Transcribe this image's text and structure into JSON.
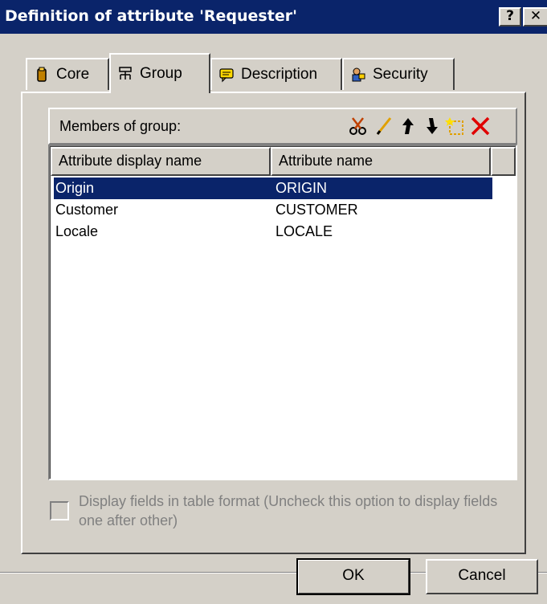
{
  "window": {
    "title": "Definition of attribute 'Requester'",
    "help_label": "?",
    "close_label": "✕"
  },
  "tabs": [
    {
      "label": "Core",
      "icon": "core-icon"
    },
    {
      "label": "Group",
      "icon": "group-icon",
      "active": true
    },
    {
      "label": "Description",
      "icon": "description-icon"
    },
    {
      "label": "Security",
      "icon": "security-icon"
    }
  ],
  "members": {
    "label": "Members of group:",
    "toolbar": [
      "cut-icon",
      "edit-icon",
      "move-up-icon",
      "move-down-icon",
      "new-icon",
      "delete-icon"
    ]
  },
  "table": {
    "columns": [
      "Attribute display name",
      "Attribute name"
    ],
    "rows": [
      {
        "display": "Origin",
        "name": "ORIGIN",
        "selected": true
      },
      {
        "display": "Customer",
        "name": "CUSTOMER"
      },
      {
        "display": "Locale",
        "name": "LOCALE"
      }
    ]
  },
  "options": {
    "table_format_label": "Display fields in table format (Uncheck this option to display fields one after other)",
    "table_format_checked": false
  },
  "buttons": {
    "ok": "OK",
    "cancel": "Cancel"
  },
  "colors": {
    "titlebar": "#0a246a",
    "selection": "#0a246a",
    "face": "#d4d0c8"
  }
}
